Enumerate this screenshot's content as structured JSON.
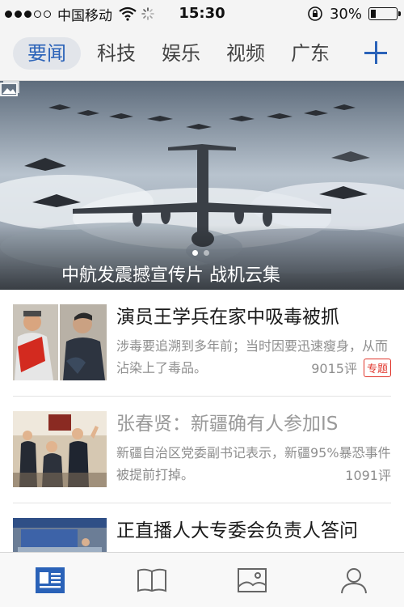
{
  "status_bar": {
    "carrier": "中国移动",
    "time": "15:30",
    "battery_text": "30%",
    "battery_level": 0.3,
    "signal_bars_filled": 3,
    "signal_bars_total": 5
  },
  "tabs": [
    {
      "label": "要闻",
      "active": true
    },
    {
      "label": "科技",
      "active": false
    },
    {
      "label": "娱乐",
      "active": false
    },
    {
      "label": "视频",
      "active": false
    },
    {
      "label": "广东",
      "active": false
    }
  ],
  "hero": {
    "caption": "中航发震撼宣传片 战机云集",
    "icon": "gallery-icon",
    "page_count": 2,
    "current_page": 1
  },
  "news": [
    {
      "headline": "演员王学兵在家中吸毒被抓",
      "summary": "涉毒要追溯到多年前；当时因要迅速瘦身，从而沾染上了毒品。",
      "comments": "9015评",
      "tag": "专题",
      "read": false
    },
    {
      "headline": "张春贤：新疆确有人参加IS",
      "summary": "新疆自治区党委副书记表示，新疆95%暴恐事件被提前打掉。",
      "comments": "1091评",
      "tag": "",
      "read": true
    },
    {
      "headline": "正直播人大专委会负责人答问",
      "summary": "",
      "comments": "",
      "tag": "",
      "read": false
    }
  ],
  "bottom_nav": [
    {
      "icon": "news-icon",
      "active": true
    },
    {
      "icon": "book-icon",
      "active": false
    },
    {
      "icon": "image-icon",
      "active": false
    },
    {
      "icon": "profile-icon",
      "active": false
    }
  ],
  "colors": {
    "accent": "#2a62b8",
    "tag_red": "#e0352b",
    "read_gray": "#9a9a9a"
  }
}
